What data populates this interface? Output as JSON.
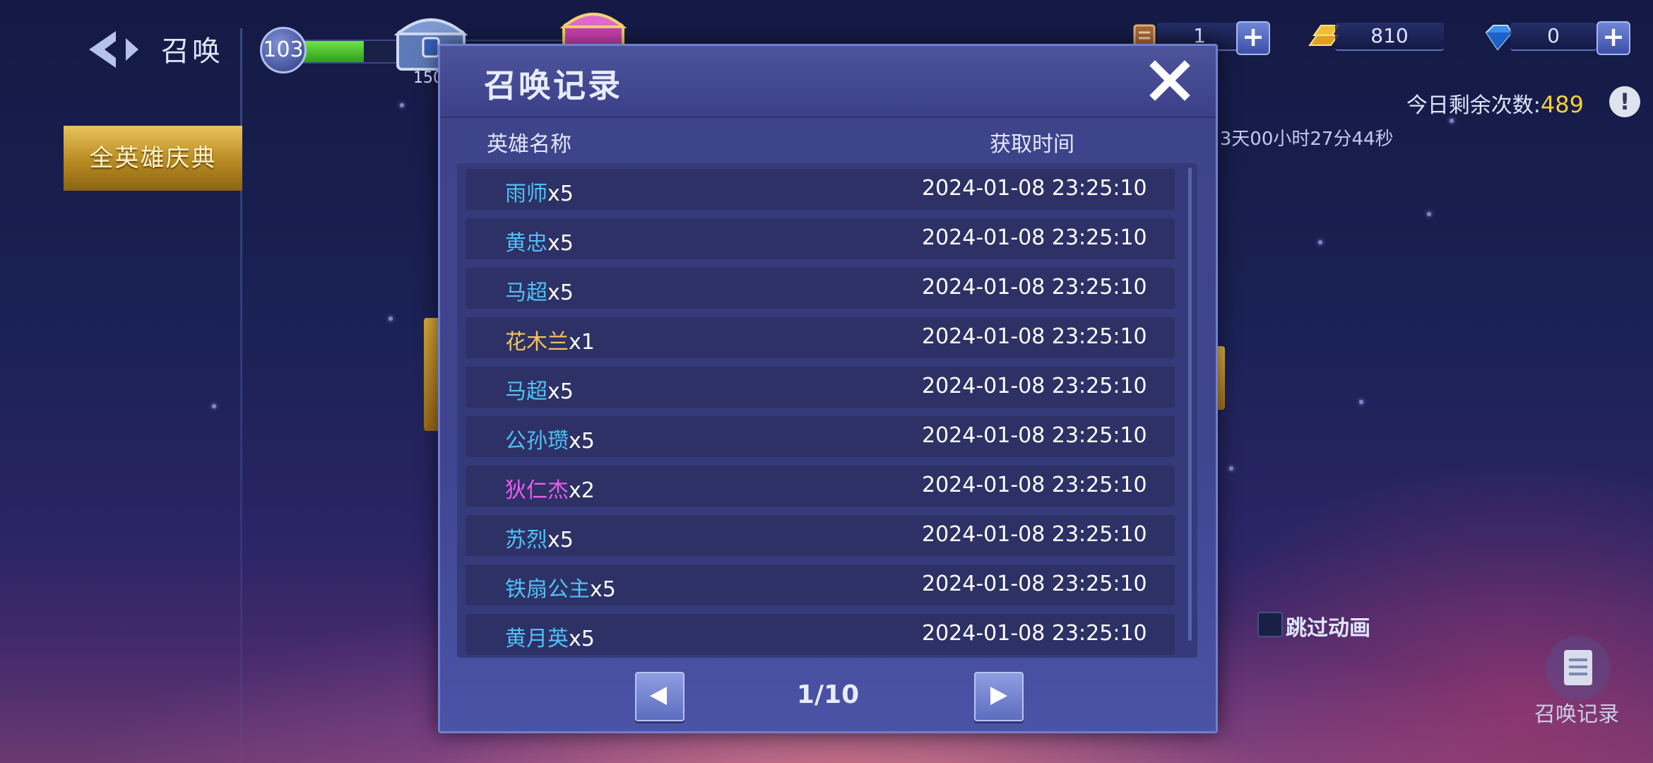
{
  "header": {
    "title": "召唤",
    "level": "103",
    "xp_progress": 0.2,
    "chest_count_partial": "150",
    "festival_tab": "全英雄庆典"
  },
  "resources": [
    {
      "name": "summon-ticket",
      "icon": "scroll-icon",
      "value": "1"
    },
    {
      "name": "gold",
      "icon": "gold-bar-icon",
      "value": "810"
    },
    {
      "name": "diamond",
      "icon": "diamond-icon",
      "value": "0"
    }
  ],
  "remaining": {
    "label": "今日剩余次数:",
    "value": "489"
  },
  "countdown": ":3天00小时27分44秒",
  "skip_animation": "跳过动画",
  "record_button": "召唤记录",
  "modal": {
    "title": "召唤记录",
    "col_name": "英雄名称",
    "col_time": "获取时间",
    "page": "1/10",
    "rows": [
      {
        "hero": "雨师",
        "count": "x5",
        "color": "#4fc1f5",
        "time": "2024-01-08 23:25:10"
      },
      {
        "hero": "黄忠",
        "count": "x5",
        "color": "#4fc1f5",
        "time": "2024-01-08 23:25:10"
      },
      {
        "hero": "马超",
        "count": "x5",
        "color": "#4fc1f5",
        "time": "2024-01-08 23:25:10"
      },
      {
        "hero": "花木兰",
        "count": "x1",
        "color": "#f2c45a",
        "time": "2024-01-08 23:25:10"
      },
      {
        "hero": "马超",
        "count": "x5",
        "color": "#4fc1f5",
        "time": "2024-01-08 23:25:10"
      },
      {
        "hero": "公孙瓒",
        "count": "x5",
        "color": "#4fc1f5",
        "time": "2024-01-08 23:25:10"
      },
      {
        "hero": "狄仁杰",
        "count": "x2",
        "color": "#ea5df0",
        "time": "2024-01-08 23:25:10"
      },
      {
        "hero": "苏烈",
        "count": "x5",
        "color": "#4fc1f5",
        "time": "2024-01-08 23:25:10"
      },
      {
        "hero": "铁扇公主",
        "count": "x5",
        "color": "#4fc1f5",
        "time": "2024-01-08 23:25:10"
      },
      {
        "hero": "黄月英",
        "count": "x5",
        "color": "#4fc1f5",
        "time": "2024-01-08 23:25:10"
      }
    ]
  }
}
